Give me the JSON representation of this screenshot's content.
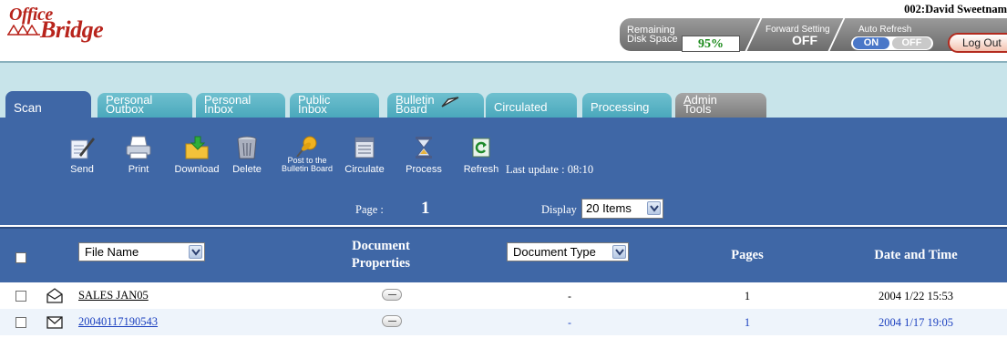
{
  "app": {
    "logo_top": "Office",
    "logo_bottom": "Bridge",
    "user": "002:David Sweetnam",
    "brand_color": "#b8241c",
    "accent_color": "#3f67a6"
  },
  "status": {
    "disk_label_1": "Remaining",
    "disk_label_2": "Disk Space",
    "disk_value": "95%",
    "forward_label": "Forward Setting",
    "forward_value": "OFF",
    "auto_refresh_label": "Auto Refresh",
    "auto_on": "ON",
    "auto_off": "OFF",
    "auto_refresh_state": "ON",
    "logout_label": "Log Out"
  },
  "tabs": [
    {
      "line1": "Scan",
      "line2": "",
      "active": true
    },
    {
      "line1": "Personal",
      "line2": "Outbox"
    },
    {
      "line1": "Personal",
      "line2": "Inbox"
    },
    {
      "line1": "Public",
      "line2": "Inbox"
    },
    {
      "line1": "Bulletin",
      "line2": "Board",
      "icon": "envelope-icon"
    },
    {
      "line1": "Circulated",
      "line2": ""
    },
    {
      "line1": "Processing",
      "line2": ""
    },
    {
      "line1": "Admin",
      "line2": "Tools"
    }
  ],
  "toolbar": {
    "send": "Send",
    "print": "Print",
    "download": "Download",
    "delete": "Delete",
    "post_line1": "Post to the",
    "post_line2": "Bulletin Board",
    "circulate": "Circulate",
    "process": "Process",
    "refresh": "Refresh",
    "last_update": "Last update : 08:10",
    "page_label": "Page :",
    "page_number": "1",
    "display_label": "Display",
    "display_value": "20 Items"
  },
  "table": {
    "file_name_select": "File Name",
    "doc_props_line1": "Document",
    "doc_props_line2": "Properties",
    "doc_type_select": "Document Type",
    "pages_header": "Pages",
    "date_header": "Date and Time",
    "rows": [
      {
        "file_name": "SALES JAN05",
        "doc_type": "-",
        "pages": "1",
        "date_time": "2004 1/22 15:53",
        "opened": true,
        "color": "#000000"
      },
      {
        "file_name": "20040117190543",
        "doc_type": "-",
        "pages": "1",
        "date_time": "2004 1/17 19:05",
        "opened": false,
        "color": "#1a3fbf"
      }
    ]
  }
}
